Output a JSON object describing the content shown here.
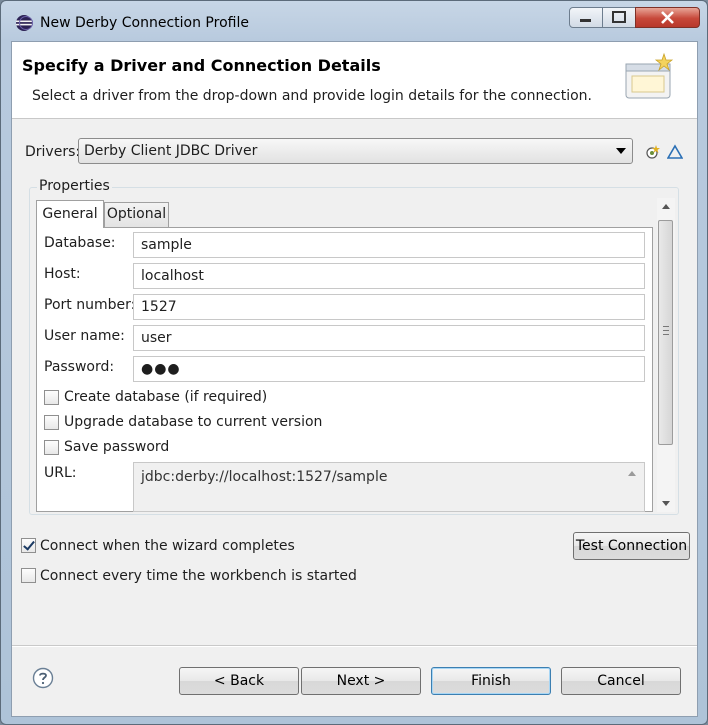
{
  "window": {
    "title": "New Derby Connection Profile"
  },
  "banner": {
    "title": "Specify a Driver and Connection Details",
    "description": "Select a driver from the drop-down and provide login details for the connection."
  },
  "drivers": {
    "label": "Drivers:",
    "selected": "Derby Client JDBC Driver"
  },
  "properties": {
    "group_label": "Properties",
    "tabs": [
      {
        "label": "General",
        "active": true
      },
      {
        "label": "Optional",
        "active": false
      }
    ],
    "fields": {
      "database": {
        "label": "Database:",
        "value": "sample"
      },
      "host": {
        "label": "Host:",
        "value": "localhost"
      },
      "port": {
        "label": "Port number:",
        "value": "1527"
      },
      "user": {
        "label": "User name:",
        "value": "user"
      },
      "password": {
        "label": "Password:",
        "value": "●●●"
      }
    },
    "checkboxes": {
      "create_db": {
        "label": "Create database (if required)",
        "checked": false
      },
      "upgrade_db": {
        "label": "Upgrade database to current version",
        "checked": false
      },
      "save_password": {
        "label": "Save password",
        "checked": false
      }
    },
    "url": {
      "label": "URL:",
      "value": "jdbc:derby://localhost:1527/sample"
    }
  },
  "options": {
    "connect_on_finish": {
      "label": "Connect when the wizard completes",
      "checked": true
    },
    "connect_on_startup": {
      "label": "Connect every time the workbench is started",
      "checked": false
    }
  },
  "buttons": {
    "test_connection": "Test Connection",
    "back": "< Back",
    "next": "Next >",
    "finish": "Finish",
    "cancel": "Cancel"
  },
  "colors": {
    "accent": "#3c7fb1",
    "close": "#c7483a"
  }
}
